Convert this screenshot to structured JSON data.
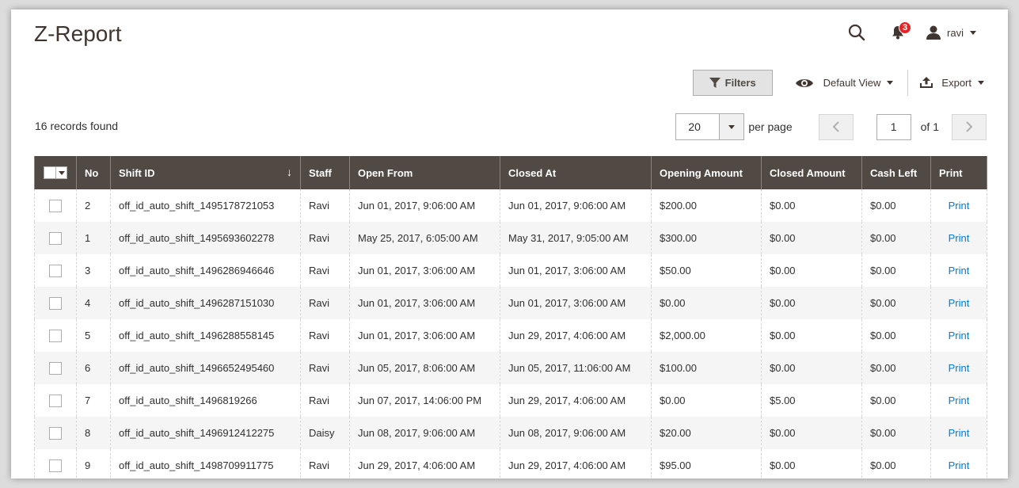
{
  "page": {
    "title": "Z-Report"
  },
  "header": {
    "notifications_count": "3",
    "user_name": "ravi"
  },
  "toolbar": {
    "filters_label": "Filters",
    "view_label": "Default View",
    "export_label": "Export"
  },
  "grid_info": {
    "records_found": "16 records found"
  },
  "pager": {
    "per_page_value": "20",
    "per_page_label": "per page",
    "current_page": "1",
    "of_label": "of 1"
  },
  "columns": [
    "No",
    "Shift ID",
    "Staff",
    "Open From",
    "Closed At",
    "Opening Amount",
    "Closed Amount",
    "Cash Left",
    "Print"
  ],
  "rows": [
    {
      "no": "2",
      "shift_id": "off_id_auto_shift_1495178721053",
      "staff": "Ravi",
      "open_from": "Jun 01, 2017, 9:06:00 AM",
      "closed_at": "Jun 01, 2017, 9:06:00 AM",
      "opening": "$200.00",
      "closed": "$0.00",
      "cash_left": "$0.00",
      "print": "Print"
    },
    {
      "no": "1",
      "shift_id": "off_id_auto_shift_1495693602278",
      "staff": "Ravi",
      "open_from": "May 25, 2017, 6:05:00 AM",
      "closed_at": "May 31, 2017, 9:05:00 AM",
      "opening": "$300.00",
      "closed": "$0.00",
      "cash_left": "$0.00",
      "print": "Print"
    },
    {
      "no": "3",
      "shift_id": "off_id_auto_shift_1496286946646",
      "staff": "Ravi",
      "open_from": "Jun 01, 2017, 3:06:00 AM",
      "closed_at": "Jun 01, 2017, 3:06:00 AM",
      "opening": "$50.00",
      "closed": "$0.00",
      "cash_left": "$0.00",
      "print": "Print"
    },
    {
      "no": "4",
      "shift_id": "off_id_auto_shift_1496287151030",
      "staff": "Ravi",
      "open_from": "Jun 01, 2017, 3:06:00 AM",
      "closed_at": "Jun 01, 2017, 3:06:00 AM",
      "opening": "$0.00",
      "closed": "$0.00",
      "cash_left": "$0.00",
      "print": "Print"
    },
    {
      "no": "5",
      "shift_id": "off_id_auto_shift_1496288558145",
      "staff": "Ravi",
      "open_from": "Jun 01, 2017, 3:06:00 AM",
      "closed_at": "Jun 29, 2017, 4:06:00 AM",
      "opening": "$2,000.00",
      "closed": "$0.00",
      "cash_left": "$0.00",
      "print": "Print"
    },
    {
      "no": "6",
      "shift_id": "off_id_auto_shift_1496652495460",
      "staff": "Ravi",
      "open_from": "Jun 05, 2017, 8:06:00 AM",
      "closed_at": "Jun 05, 2017, 11:06:00 AM",
      "opening": "$100.00",
      "closed": "$0.00",
      "cash_left": "$0.00",
      "print": "Print"
    },
    {
      "no": "7",
      "shift_id": "off_id_auto_shift_1496819266",
      "staff": "Ravi",
      "open_from": "Jun 07, 2017, 14:06:00 PM",
      "closed_at": "Jun 29, 2017, 4:06:00 AM",
      "opening": "$0.00",
      "closed": "$5.00",
      "cash_left": "$0.00",
      "print": "Print"
    },
    {
      "no": "8",
      "shift_id": "off_id_auto_shift_1496912412275",
      "staff": "Daisy",
      "open_from": "Jun 08, 2017, 9:06:00 AM",
      "closed_at": "Jun 08, 2017, 9:06:00 AM",
      "opening": "$20.00",
      "closed": "$0.00",
      "cash_left": "$0.00",
      "print": "Print"
    },
    {
      "no": "9",
      "shift_id": "off_id_auto_shift_1498709911775",
      "staff": "Ravi",
      "open_from": "Jun 29, 2017, 4:06:00 AM",
      "closed_at": "Jun 29, 2017, 4:06:00 AM",
      "opening": "$95.00",
      "closed": "$0.00",
      "cash_left": "$0.00",
      "print": "Print"
    }
  ],
  "icons": {
    "search": "search-icon",
    "bell": "bell-icon",
    "user": "user-icon",
    "filter": "funnel-icon",
    "view": "eye-icon",
    "export": "export-icon",
    "sort": "sort-down-arrow"
  },
  "colors": {
    "header_bg": "#514943",
    "link": "#007bdb",
    "badge": "#e22626"
  }
}
